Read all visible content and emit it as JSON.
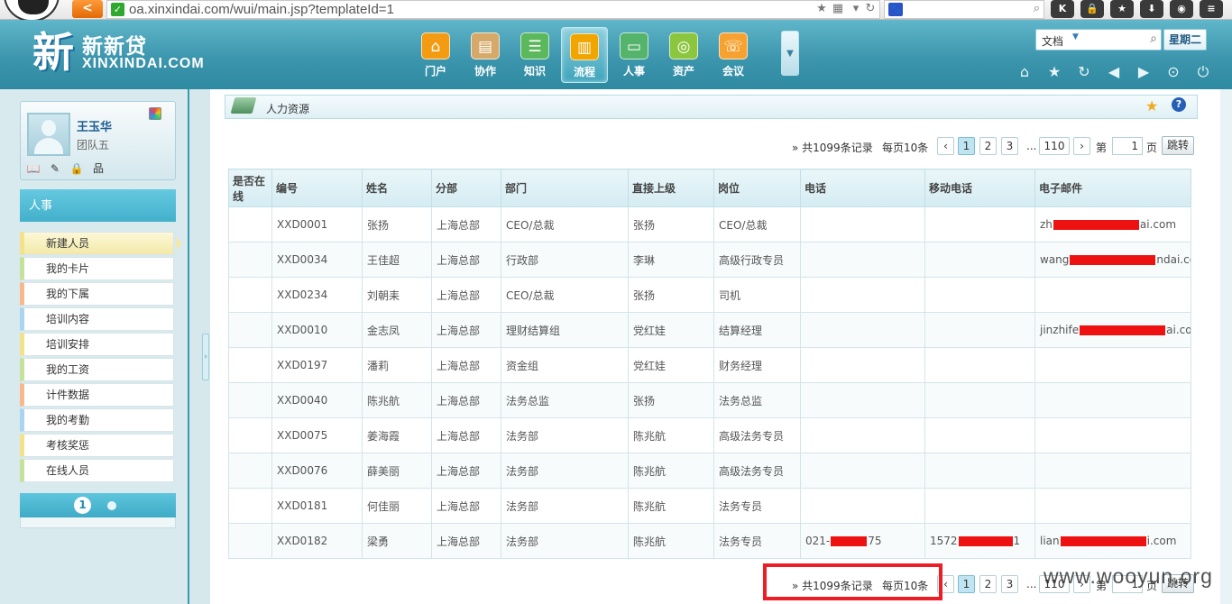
{
  "browser": {
    "url": "oa.xinxindai.com/wui/main.jsp?templateId=1",
    "back_glyph": "<",
    "secure_glyph": "✓",
    "paw_glyph": "🐾",
    "toolbar_buttons": [
      {
        "icon": "k-icon",
        "glyph": "K"
      },
      {
        "icon": "lock-icon",
        "glyph": "🔒"
      },
      {
        "icon": "star-icon",
        "glyph": "★"
      },
      {
        "icon": "download-icon",
        "glyph": "⬇"
      },
      {
        "icon": "gamepad-icon",
        "glyph": "◉"
      },
      {
        "icon": "menu-icon",
        "glyph": "≡"
      }
    ]
  },
  "logo": {
    "mark": "新",
    "name_cn": "新新贷",
    "name_en": "XINXINDAI.COM"
  },
  "nav": {
    "items": [
      {
        "label": "门户",
        "icon": "home-icon",
        "glyph": "⌂",
        "color": "#f39c12"
      },
      {
        "label": "协作",
        "icon": "document-icon",
        "glyph": "▤",
        "color": "#d6a96a"
      },
      {
        "label": "知识",
        "icon": "server-icon",
        "glyph": "☰",
        "color": "#5cb85c"
      },
      {
        "label": "流程",
        "icon": "bar-chart-icon",
        "glyph": "▥",
        "color": "#f0a500"
      },
      {
        "label": "人事",
        "icon": "person-card-icon",
        "glyph": "▭",
        "color": "#55b46c"
      },
      {
        "label": "资产",
        "icon": "coins-icon",
        "glyph": "◎",
        "color": "#8cc63f"
      },
      {
        "label": "会议",
        "icon": "phone-icon",
        "glyph": "☏",
        "color": "#f7a230"
      }
    ],
    "active_index": 3,
    "more_glyph": "▼"
  },
  "header_search": {
    "category": "文档",
    "weekday": "星期二"
  },
  "header_tools": [
    {
      "icon": "home-icon",
      "glyph": "⌂"
    },
    {
      "icon": "favorite-star-icon",
      "glyph": "★"
    },
    {
      "icon": "refresh-icon",
      "glyph": "↻"
    },
    {
      "icon": "back-arrow-icon",
      "glyph": "◀"
    },
    {
      "icon": "forward-arrow-icon",
      "glyph": "▶"
    },
    {
      "icon": "dropdown-circle-icon",
      "glyph": "⊙"
    },
    {
      "icon": "power-icon",
      "glyph": "⏻"
    }
  ],
  "user": {
    "name": "王玉华",
    "team": "团队五",
    "tools": [
      {
        "icon": "book-icon",
        "glyph": "📖"
      },
      {
        "icon": "edit-note-icon",
        "glyph": "✎"
      },
      {
        "icon": "lock-icon",
        "glyph": "🔒"
      },
      {
        "icon": "org-chart-icon",
        "glyph": "品"
      }
    ]
  },
  "sidebar": {
    "section_title": "人事",
    "items": [
      {
        "label": "新建人员",
        "color": "#f4e28a"
      },
      {
        "label": "我的卡片",
        "color": "#c5e29b"
      },
      {
        "label": "我的下属",
        "color": "#f6b98e"
      },
      {
        "label": "培训内容",
        "color": "#a9d6ee"
      },
      {
        "label": "培训安排",
        "color": "#f4e28a"
      },
      {
        "label": "我的工资",
        "color": "#c5e29b"
      },
      {
        "label": "计件数据",
        "color": "#f6b98e"
      },
      {
        "label": "我的考勤",
        "color": "#a9d6ee"
      },
      {
        "label": "考核奖惩",
        "color": "#f4e28a"
      },
      {
        "label": "在线人员",
        "color": "#c5e29b"
      }
    ],
    "active_index": 0,
    "pager_current": "1"
  },
  "portlet": {
    "title": "人力资源",
    "fav_glyph": "★",
    "help_glyph": "?"
  },
  "pager": {
    "total_prefix": "» 共1099条记录",
    "per_page": "每页10条",
    "prev_glyph": "‹",
    "next_glyph": "›",
    "pages": [
      "1",
      "2",
      "3"
    ],
    "ellipsis": "...",
    "last_page": "110",
    "goto_label": "第",
    "goto_value": "1",
    "page_suffix": "页",
    "jump_label": "跳转"
  },
  "table": {
    "headers": [
      "是否在线",
      "编号",
      "姓名",
      "分部",
      "部门",
      "直接上级",
      "岗位",
      "电话",
      "移动电话",
      "电子邮件"
    ],
    "rows": [
      {
        "online": "",
        "id": "XXD0001",
        "name": "张扬",
        "branch": "上海总部",
        "dept": "CEO/总裁",
        "manager": "张扬",
        "position": "CEO/总裁",
        "phone_a": "",
        "phone_b": "",
        "mobile_a": "",
        "mobile_b": "",
        "email_a": "zh",
        "email_b": "ai.com"
      },
      {
        "online": "",
        "id": "XXD0034",
        "name": "王佳超",
        "branch": "上海总部",
        "dept": "行政部",
        "manager": "李琳",
        "position": "高级行政专员",
        "phone_a": "",
        "phone_b": "",
        "mobile_a": "",
        "mobile_b": "",
        "email_a": "wang",
        "email_b": "ndai.com"
      },
      {
        "online": "",
        "id": "XXD0234",
        "name": "刘朝耒",
        "branch": "上海总部",
        "dept": "CEO/总裁",
        "manager": "张扬",
        "position": "司机",
        "phone_a": "",
        "phone_b": "",
        "mobile_a": "",
        "mobile_b": "",
        "email_a": "",
        "email_b": ""
      },
      {
        "online": "",
        "id": "XXD0010",
        "name": "金志凤",
        "branch": "上海总部",
        "dept": "理财结算组",
        "manager": "党红娃",
        "position": "结算经理",
        "phone_a": "",
        "phone_b": "",
        "mobile_a": "",
        "mobile_b": "",
        "email_a": "jinzhife",
        "email_b": "ai.com"
      },
      {
        "online": "",
        "id": "XXD0197",
        "name": "潘莉",
        "branch": "上海总部",
        "dept": "资金组",
        "manager": "党红娃",
        "position": "财务经理",
        "phone_a": "",
        "phone_b": "",
        "mobile_a": "",
        "mobile_b": "",
        "email_a": "",
        "email_b": ""
      },
      {
        "online": "",
        "id": "XXD0040",
        "name": "陈兆航",
        "branch": "上海总部",
        "dept": "法务总监",
        "manager": "张扬",
        "position": "法务总监",
        "phone_a": "",
        "phone_b": "",
        "mobile_a": "",
        "mobile_b": "",
        "email_a": "",
        "email_b": ""
      },
      {
        "online": "",
        "id": "XXD0075",
        "name": "姜海霞",
        "branch": "上海总部",
        "dept": "法务部",
        "manager": "陈兆航",
        "position": "高级法务专员",
        "phone_a": "",
        "phone_b": "",
        "mobile_a": "",
        "mobile_b": "",
        "email_a": "",
        "email_b": ""
      },
      {
        "online": "",
        "id": "XXD0076",
        "name": "薛美丽",
        "branch": "上海总部",
        "dept": "法务部",
        "manager": "陈兆航",
        "position": "高级法务专员",
        "phone_a": "",
        "phone_b": "",
        "mobile_a": "",
        "mobile_b": "",
        "email_a": "",
        "email_b": ""
      },
      {
        "online": "",
        "id": "XXD0181",
        "name": "何佳丽",
        "branch": "上海总部",
        "dept": "法务部",
        "manager": "陈兆航",
        "position": "法务专员",
        "phone_a": "",
        "phone_b": "",
        "mobile_a": "",
        "mobile_b": "",
        "email_a": "",
        "email_b": ""
      },
      {
        "online": "",
        "id": "XXD0182",
        "name": "梁勇",
        "branch": "上海总部",
        "dept": "法务部",
        "manager": "陈兆航",
        "position": "法务专员",
        "phone_a": "021-",
        "phone_b": "75",
        "mobile_a": "1572",
        "mobile_b": "1",
        "email_a": "lian",
        "email_b": "i.com"
      }
    ]
  },
  "watermark": "www.wooyun.org",
  "colors": {
    "header_teal": "#3c96ad",
    "redaction": "#ee1111",
    "highlight_box": "#ee1c24"
  }
}
